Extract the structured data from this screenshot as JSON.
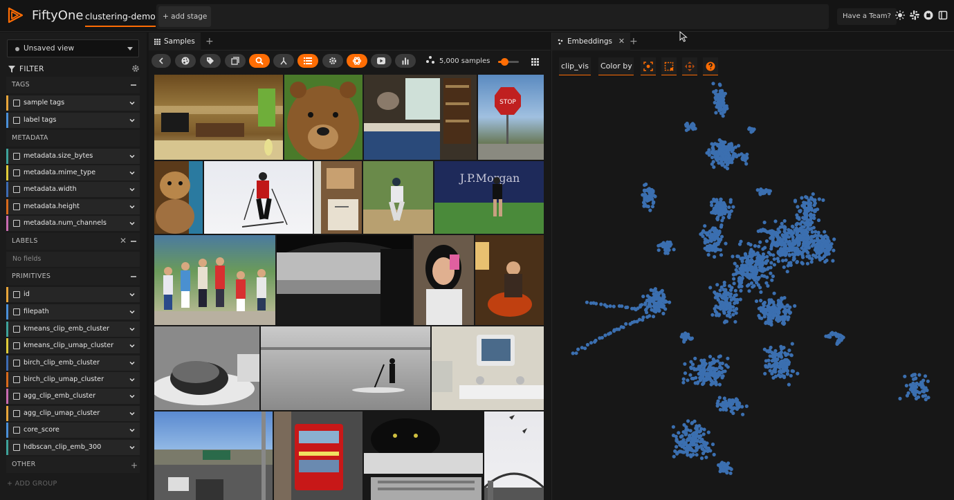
{
  "header": {
    "brand": "FiftyOne",
    "dataset": "clustering-demo",
    "add_stage": "+ add stage",
    "team_button": "Have a Team?",
    "icons": [
      "sun-icon",
      "slack-icon",
      "github-icon",
      "book-icon"
    ],
    "accent": "#ff6d04"
  },
  "sidebar": {
    "view_select": "Unsaved view",
    "filter_label": "FILTER",
    "groups": [
      {
        "label": "TAGS",
        "fields": [
          {
            "label": "sample tags",
            "color": "#e8a53a"
          },
          {
            "label": "label tags",
            "color": "#4a90d9"
          }
        ]
      },
      {
        "label": "METADATA",
        "fields": [
          {
            "label": "metadata.size_bytes",
            "color": "#3ea29a"
          },
          {
            "label": "metadata.mime_type",
            "color": "#e0cc3a"
          },
          {
            "label": "metadata.width",
            "color": "#3d6bb3"
          },
          {
            "label": "metadata.height",
            "color": "#d86a1c"
          },
          {
            "label": "metadata.num_channels",
            "color": "#c86bb0"
          }
        ]
      },
      {
        "label": "LABELS",
        "empty": "No fields"
      },
      {
        "label": "PRIMITIVES",
        "fields": [
          {
            "label": "id",
            "color": "#e8a53a"
          },
          {
            "label": "filepath",
            "color": "#4a90d9"
          },
          {
            "label": "kmeans_clip_emb_cluster",
            "color": "#3ea29a"
          },
          {
            "label": "kmeans_clip_umap_cluster",
            "color": "#e0cc3a"
          },
          {
            "label": "birch_clip_emb_cluster",
            "color": "#3d6bb3"
          },
          {
            "label": "birch_clip_umap_cluster",
            "color": "#d86a1c"
          },
          {
            "label": "agg_clip_emb_cluster",
            "color": "#c86bb0"
          },
          {
            "label": "agg_clip_umap_cluster",
            "color": "#e8a53a"
          },
          {
            "label": "core_score",
            "color": "#4a90d9"
          },
          {
            "label": "hdbscan_clip_emb_300",
            "color": "#3ea29a"
          }
        ]
      },
      {
        "label": "OTHER"
      }
    ],
    "add_group": "+ ADD GROUP"
  },
  "samples": {
    "tab_label": "Samples",
    "sample_count": "5,000 samples",
    "zoom_level": 0.3,
    "toolbar_icons": [
      "back-icon",
      "palette-icon",
      "tag-icon",
      "patches-icon",
      "search-icon",
      "merge-icon",
      "list-icon",
      "gear-icon",
      "openai-icon",
      "video-icon",
      "bar-chart-icon"
    ],
    "toolbar_active": [
      "search-icon",
      "list-icon",
      "openai-icon"
    ]
  },
  "embeddings": {
    "tab_label": "Embeddings",
    "brain_key": "clip_vis",
    "color_by": "Color by",
    "tool_icons": [
      "lasso-icon",
      "box-select-icon",
      "pan-icon",
      "help-icon"
    ],
    "point_color": "#3b6fb0"
  }
}
